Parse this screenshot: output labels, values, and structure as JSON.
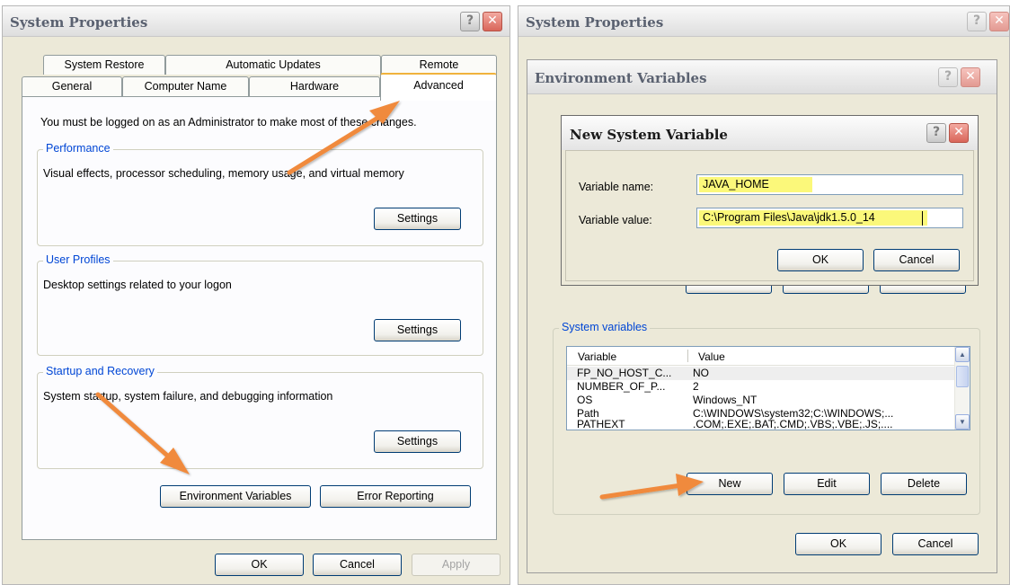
{
  "left_window": {
    "title": "System Properties",
    "tabs_row_back": [
      "System Restore",
      "Automatic Updates",
      "Remote"
    ],
    "tabs_row_front": [
      "General",
      "Computer Name",
      "Hardware",
      "Advanced"
    ],
    "admin_notice": "You must be logged on as an Administrator to make most of these changes.",
    "performance": {
      "label": "Performance",
      "description": "Visual effects, processor scheduling, memory usage, and virtual memory",
      "button": "Settings"
    },
    "user_profiles": {
      "label": "User Profiles",
      "description": "Desktop settings related to your logon",
      "button": "Settings"
    },
    "startup_recovery": {
      "label": "Startup and Recovery",
      "description": "System startup, system failure, and debugging information",
      "button": "Settings"
    },
    "env_vars_button": "Environment Variables",
    "error_reporting_button": "Error Reporting",
    "ok_button": "OK",
    "cancel_button": "Cancel",
    "apply_button": "Apply"
  },
  "right_window": {
    "title": "System Properties",
    "env_dialog": {
      "title": "Environment Variables",
      "system_variables_label": "System variables",
      "columns": [
        "Variable",
        "Value"
      ],
      "rows": [
        {
          "name": "FP_NO_HOST_C...",
          "value": "NO"
        },
        {
          "name": "NUMBER_OF_P...",
          "value": "2"
        },
        {
          "name": "OS",
          "value": "Windows_NT"
        },
        {
          "name": "Path",
          "value": "C:\\WINDOWS\\system32;C:\\WINDOWS;..."
        },
        {
          "name": "PATHEXT",
          "value": ".COM;.EXE;.BAT;.CMD;.VBS;.VBE;.JS;...."
        }
      ],
      "new_button": "New",
      "edit_button": "Edit",
      "delete_button": "Delete",
      "ok_button": "OK",
      "cancel_button": "Cancel"
    },
    "new_var_dialog": {
      "title": "New System Variable",
      "name_label": "Variable name:",
      "name_value": "JAVA_HOME",
      "value_label": "Variable value:",
      "value_value": "C:\\Program Files\\Java\\jdk1.5.0_14",
      "ok_button": "OK",
      "cancel_button": "Cancel"
    }
  },
  "colors": {
    "annotation_arrow": "#f08a3c",
    "highlight": "#fbf87a",
    "group_label": "#0046d5",
    "active_tab_accent": "#f0b33d"
  }
}
